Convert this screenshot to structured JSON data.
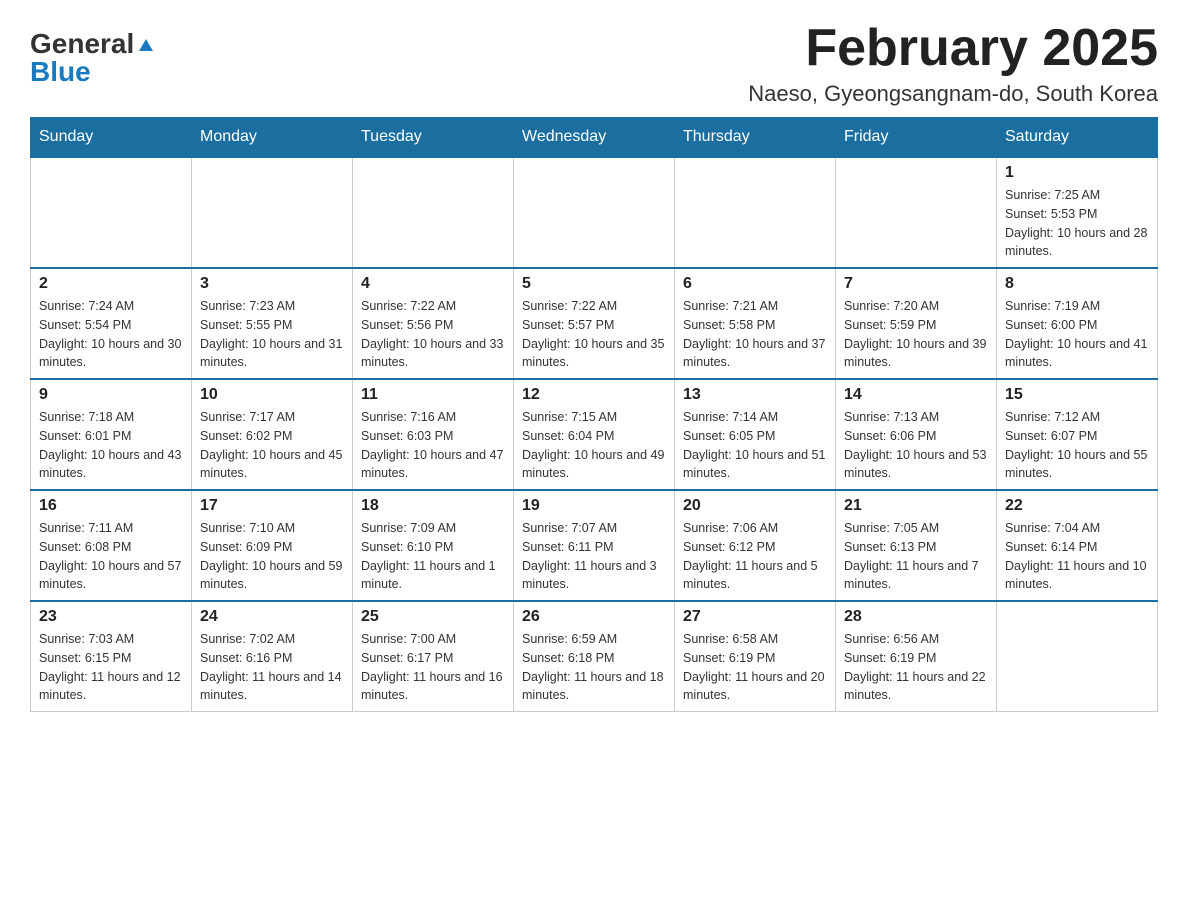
{
  "header": {
    "logo": {
      "general": "General",
      "blue": "Blue",
      "triangle": "▲"
    },
    "title": "February 2025",
    "location": "Naeso, Gyeongsangnam-do, South Korea"
  },
  "days_of_week": [
    "Sunday",
    "Monday",
    "Tuesday",
    "Wednesday",
    "Thursday",
    "Friday",
    "Saturday"
  ],
  "weeks": [
    [
      null,
      null,
      null,
      null,
      null,
      null,
      {
        "day": "1",
        "sunrise": "Sunrise: 7:25 AM",
        "sunset": "Sunset: 5:53 PM",
        "daylight": "Daylight: 10 hours and 28 minutes."
      }
    ],
    [
      {
        "day": "2",
        "sunrise": "Sunrise: 7:24 AM",
        "sunset": "Sunset: 5:54 PM",
        "daylight": "Daylight: 10 hours and 30 minutes."
      },
      {
        "day": "3",
        "sunrise": "Sunrise: 7:23 AM",
        "sunset": "Sunset: 5:55 PM",
        "daylight": "Daylight: 10 hours and 31 minutes."
      },
      {
        "day": "4",
        "sunrise": "Sunrise: 7:22 AM",
        "sunset": "Sunset: 5:56 PM",
        "daylight": "Daylight: 10 hours and 33 minutes."
      },
      {
        "day": "5",
        "sunrise": "Sunrise: 7:22 AM",
        "sunset": "Sunset: 5:57 PM",
        "daylight": "Daylight: 10 hours and 35 minutes."
      },
      {
        "day": "6",
        "sunrise": "Sunrise: 7:21 AM",
        "sunset": "Sunset: 5:58 PM",
        "daylight": "Daylight: 10 hours and 37 minutes."
      },
      {
        "day": "7",
        "sunrise": "Sunrise: 7:20 AM",
        "sunset": "Sunset: 5:59 PM",
        "daylight": "Daylight: 10 hours and 39 minutes."
      },
      {
        "day": "8",
        "sunrise": "Sunrise: 7:19 AM",
        "sunset": "Sunset: 6:00 PM",
        "daylight": "Daylight: 10 hours and 41 minutes."
      }
    ],
    [
      {
        "day": "9",
        "sunrise": "Sunrise: 7:18 AM",
        "sunset": "Sunset: 6:01 PM",
        "daylight": "Daylight: 10 hours and 43 minutes."
      },
      {
        "day": "10",
        "sunrise": "Sunrise: 7:17 AM",
        "sunset": "Sunset: 6:02 PM",
        "daylight": "Daylight: 10 hours and 45 minutes."
      },
      {
        "day": "11",
        "sunrise": "Sunrise: 7:16 AM",
        "sunset": "Sunset: 6:03 PM",
        "daylight": "Daylight: 10 hours and 47 minutes."
      },
      {
        "day": "12",
        "sunrise": "Sunrise: 7:15 AM",
        "sunset": "Sunset: 6:04 PM",
        "daylight": "Daylight: 10 hours and 49 minutes."
      },
      {
        "day": "13",
        "sunrise": "Sunrise: 7:14 AM",
        "sunset": "Sunset: 6:05 PM",
        "daylight": "Daylight: 10 hours and 51 minutes."
      },
      {
        "day": "14",
        "sunrise": "Sunrise: 7:13 AM",
        "sunset": "Sunset: 6:06 PM",
        "daylight": "Daylight: 10 hours and 53 minutes."
      },
      {
        "day": "15",
        "sunrise": "Sunrise: 7:12 AM",
        "sunset": "Sunset: 6:07 PM",
        "daylight": "Daylight: 10 hours and 55 minutes."
      }
    ],
    [
      {
        "day": "16",
        "sunrise": "Sunrise: 7:11 AM",
        "sunset": "Sunset: 6:08 PM",
        "daylight": "Daylight: 10 hours and 57 minutes."
      },
      {
        "day": "17",
        "sunrise": "Sunrise: 7:10 AM",
        "sunset": "Sunset: 6:09 PM",
        "daylight": "Daylight: 10 hours and 59 minutes."
      },
      {
        "day": "18",
        "sunrise": "Sunrise: 7:09 AM",
        "sunset": "Sunset: 6:10 PM",
        "daylight": "Daylight: 11 hours and 1 minute."
      },
      {
        "day": "19",
        "sunrise": "Sunrise: 7:07 AM",
        "sunset": "Sunset: 6:11 PM",
        "daylight": "Daylight: 11 hours and 3 minutes."
      },
      {
        "day": "20",
        "sunrise": "Sunrise: 7:06 AM",
        "sunset": "Sunset: 6:12 PM",
        "daylight": "Daylight: 11 hours and 5 minutes."
      },
      {
        "day": "21",
        "sunrise": "Sunrise: 7:05 AM",
        "sunset": "Sunset: 6:13 PM",
        "daylight": "Daylight: 11 hours and 7 minutes."
      },
      {
        "day": "22",
        "sunrise": "Sunrise: 7:04 AM",
        "sunset": "Sunset: 6:14 PM",
        "daylight": "Daylight: 11 hours and 10 minutes."
      }
    ],
    [
      {
        "day": "23",
        "sunrise": "Sunrise: 7:03 AM",
        "sunset": "Sunset: 6:15 PM",
        "daylight": "Daylight: 11 hours and 12 minutes."
      },
      {
        "day": "24",
        "sunrise": "Sunrise: 7:02 AM",
        "sunset": "Sunset: 6:16 PM",
        "daylight": "Daylight: 11 hours and 14 minutes."
      },
      {
        "day": "25",
        "sunrise": "Sunrise: 7:00 AM",
        "sunset": "Sunset: 6:17 PM",
        "daylight": "Daylight: 11 hours and 16 minutes."
      },
      {
        "day": "26",
        "sunrise": "Sunrise: 6:59 AM",
        "sunset": "Sunset: 6:18 PM",
        "daylight": "Daylight: 11 hours and 18 minutes."
      },
      {
        "day": "27",
        "sunrise": "Sunrise: 6:58 AM",
        "sunset": "Sunset: 6:19 PM",
        "daylight": "Daylight: 11 hours and 20 minutes."
      },
      {
        "day": "28",
        "sunrise": "Sunrise: 6:56 AM",
        "sunset": "Sunset: 6:19 PM",
        "daylight": "Daylight: 11 hours and 22 minutes."
      },
      null
    ]
  ]
}
